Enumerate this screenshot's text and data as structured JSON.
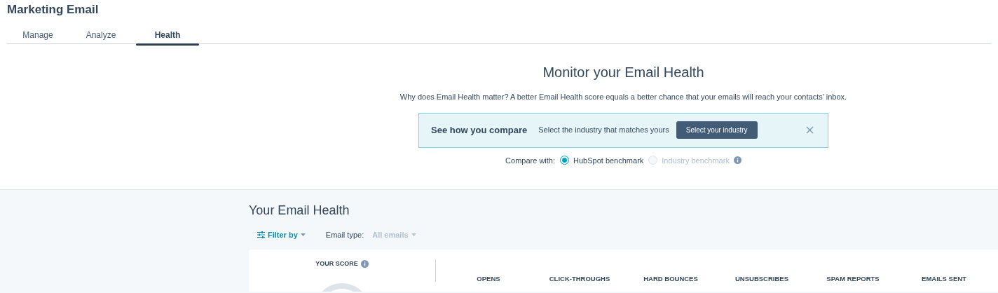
{
  "page": {
    "title": "Marketing Email"
  },
  "tabs": [
    {
      "label": "Manage",
      "selected": false
    },
    {
      "label": "Analyze",
      "selected": false
    },
    {
      "label": "Health",
      "selected": true
    }
  ],
  "intro": {
    "heading": "Monitor your Email Health",
    "text": "Why does Email Health matter? A better Email Health score equals a better chance that your emails will reach your contacts’ inbox."
  },
  "banner": {
    "title": "See how you compare",
    "text": "Select the industry that matches yours",
    "button": "Select your industry"
  },
  "compare": {
    "label": "Compare with:",
    "options": [
      {
        "label": "HubSpot benchmark",
        "selected": true,
        "disabled": false,
        "info": false
      },
      {
        "label": "Industry benchmark",
        "selected": false,
        "disabled": true,
        "info": true
      }
    ]
  },
  "health": {
    "heading": "Your Email Health",
    "filter": "Filter by",
    "email_type_label": "Email type:",
    "email_type_value": "All emails",
    "score_label": "YOUR SCORE",
    "metrics": [
      "OPENS",
      "CLICK-THROUGHS",
      "HARD BOUNCES",
      "UNSUBSCRIBES",
      "SPAM REPORTS",
      "EMAILS SENT"
    ]
  }
}
